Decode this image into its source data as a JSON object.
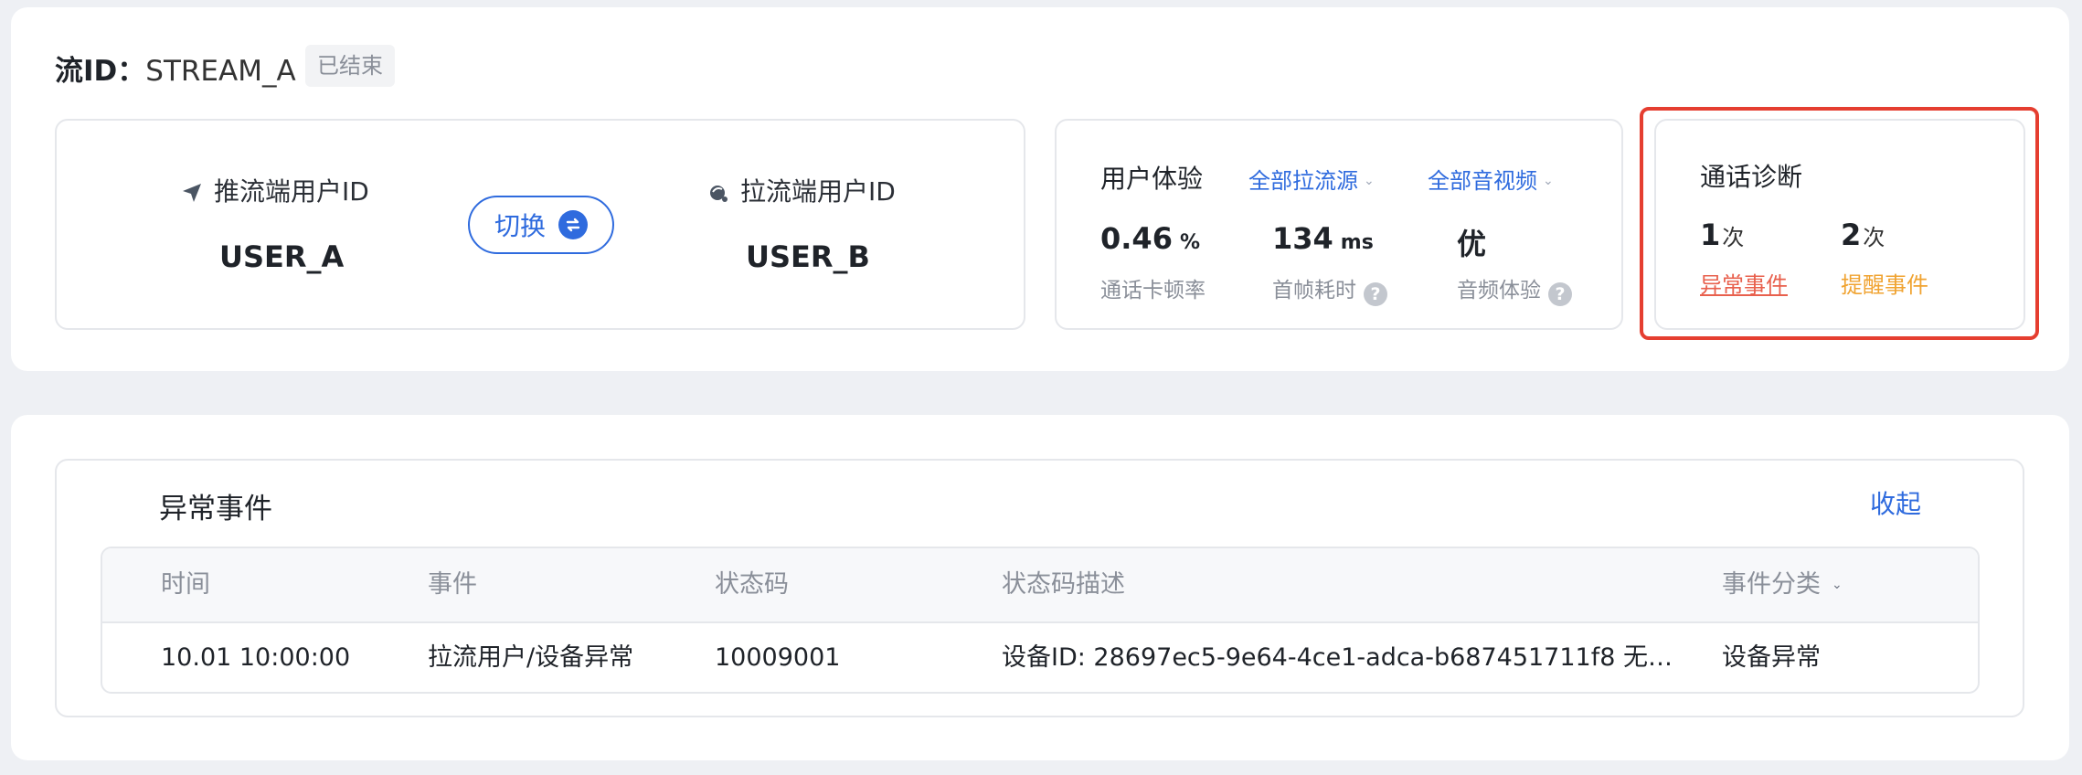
{
  "stream": {
    "label": "流ID：",
    "id": "STREAM_A",
    "status": "已结束"
  },
  "users": {
    "push_label": "推流端用户ID",
    "push_user": "USER_A",
    "pull_label": "拉流端用户ID",
    "pull_user": "USER_B",
    "switch_label": "切换",
    "push_icon": "send-arrow-icon",
    "pull_icon": "pull-stream-icon",
    "switch_icon": "swap-arrows-icon"
  },
  "ux": {
    "title": "用户体验",
    "filter_source": "全部拉流源",
    "filter_media": "全部音视频",
    "metrics": [
      {
        "value": "0.46",
        "unit": "%",
        "label": "通话卡顿率"
      },
      {
        "value": "134",
        "unit": "ms",
        "label": "首帧耗时"
      },
      {
        "value": "优",
        "unit": "",
        "label": "音频体验"
      }
    ]
  },
  "diagnosis": {
    "title": "通话诊断",
    "abnormal_count": "1",
    "abnormal_unit": "次",
    "abnormal_label": "异常事件",
    "reminder_count": "2",
    "reminder_unit": "次",
    "reminder_label": "提醒事件"
  },
  "events": {
    "title": "异常事件",
    "collapse_label": "收起",
    "columns": [
      "时间",
      "事件",
      "状态码",
      "状态码描述",
      "事件分类"
    ],
    "rows": [
      [
        "10.01 10:00:00",
        "拉流用户/设备异常",
        "10009001",
        "设备ID: 28697ec5-9e64-4ce1-adca-b687451711f8 无…",
        "设备异常"
      ]
    ]
  },
  "colors": {
    "accent": "#2f6bde",
    "highlight": "#e53e30",
    "abnormal": "#e8604d",
    "reminder": "#f0a331"
  }
}
